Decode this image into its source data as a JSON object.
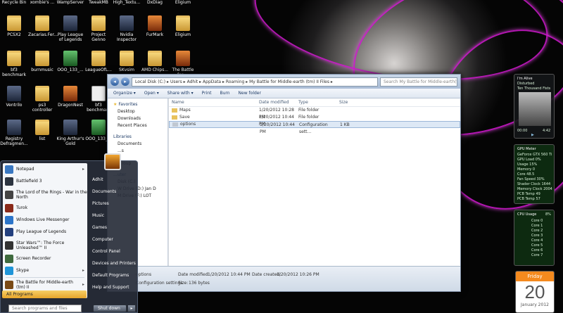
{
  "desktop": {
    "top_labels": [
      "Recycle Bin",
      "xombie's ...",
      "WampServer",
      "TweakMB",
      "High_Textu...",
      "DxDiag",
      "Eligium"
    ],
    "icons": [
      {
        "label": "PCSX2",
        "type": "folder"
      },
      {
        "label": "Zacarias.Fer...",
        "type": "folder"
      },
      {
        "label": "Play League of Legends",
        "type": "app"
      },
      {
        "label": "Project Genno",
        "type": "folder"
      },
      {
        "label": "Nvidia Inspector",
        "type": "app"
      },
      {
        "label": "FurMark",
        "type": "game"
      },
      {
        "label": "Eligium",
        "type": "folder"
      },
      {
        "label": "bf3 benchmark",
        "type": "folder"
      },
      {
        "label": "burnmusic",
        "type": "folder"
      },
      {
        "label": "OOO_133_...",
        "type": "green"
      },
      {
        "label": "LeagueOfL...",
        "type": "folder"
      },
      {
        "label": "SKvsim",
        "type": "folder"
      },
      {
        "label": "AMD Chips...",
        "type": "folder"
      },
      {
        "label": "The Battle for ...",
        "type": "game"
      },
      {
        "label": "Ventrilo",
        "type": "app"
      },
      {
        "label": "ps3 controller",
        "type": "folder"
      },
      {
        "label": "DragonNest",
        "type": "game"
      },
      {
        "label": "bf3 benchmark",
        "type": "doc"
      },
      {
        "label": "Registry Defragmen...",
        "type": "app"
      },
      {
        "label": "list",
        "type": "folder"
      },
      {
        "label": "King Arthur's Gold",
        "type": "app"
      },
      {
        "label": "OOO_133_...",
        "type": "green"
      }
    ]
  },
  "explorer": {
    "address": "Local Disk (C:)  ▸  Users  ▸  Adhit  ▸  AppData  ▸  Roaming  ▸  My Battle for Middle-earth (tm) II Files  ▸",
    "search_placeholder": "Search My Battle for Middle-earth(tm)...",
    "toolbar": [
      "Organize ▾",
      "Open ▾",
      "Share with ▾",
      "Print",
      "Burn",
      "New folder"
    ],
    "nav": {
      "favorites": "Favorites",
      "fav_items": [
        "Desktop",
        "Downloads",
        "Recent Places"
      ],
      "libraries": "Libraries",
      "lib_items": [
        "Documents"
      ],
      "lib_partial": [
        "...s",
        "...roup"
      ],
      "computer": "...uter",
      "drives": [
        "Disk (C:)",
        "W Drive (D:) Jan D",
        "M Drive (F:) LOT"
      ]
    },
    "columns": [
      "Name",
      "Date modified",
      "Type",
      "Size"
    ],
    "files": [
      {
        "name": "Maps",
        "date": "1/20/2012 10:28 PM",
        "type": "File folder",
        "size": "",
        "kind": "folder"
      },
      {
        "name": "Save",
        "date": "1/20/2012 10:44 PM",
        "type": "File folder",
        "size": "",
        "kind": "folder"
      },
      {
        "name": "options",
        "date": "1/20/2012 10:44 PM",
        "type": "Configuration sett...",
        "size": "1 KB",
        "kind": "cfg"
      }
    ],
    "details": {
      "name": "options",
      "subtype": "Configuration settings",
      "modified_label": "Date modified:",
      "modified": "1/20/2012 10:44 PM",
      "created_label": "Date created:",
      "created": "1/20/2012 10:26 PM",
      "size_label": "Size:",
      "size": "136 bytes"
    }
  },
  "startmenu": {
    "pinned": [
      "Notepad",
      "Battlefield 3",
      "The Lord of the Rings - War in the North",
      "Turok",
      "Windows Live Messenger",
      "Play League of Legends",
      "Star Wars™: The Force Unleashed™ II",
      "Screen Recorder",
      "Skype",
      "The Battle for Middle-earth (tm) II"
    ],
    "all_programs": "All Programs",
    "search_placeholder": "Search programs and files",
    "right_items": [
      "Adhit",
      "Documents",
      "Pictures",
      "Music",
      "Games",
      "Computer",
      "Control Panel",
      "Devices and Printers",
      "Default Programs",
      "Help and Support"
    ],
    "shutdown": "Shut down",
    "shutdown_arrow": "▸"
  },
  "gadgets": {
    "music": {
      "title": "I'm Alive",
      "artist": "Disturbed",
      "album": "Ten Thousand Fists",
      "time_start": "00:00",
      "time_end": "4:42"
    },
    "cpumeter": {
      "title": "GPU Meter",
      "lines": [
        "GeForce GTX 560 Ti",
        "GPU Load  0%",
        "Usage  15%",
        "Memory  0",
        "Core  48.5",
        "Fan Speed  30%",
        "Shader Clock 1644",
        "Memory Clock 2004",
        "PCB Temp 49",
        "PCB Temp 57"
      ]
    },
    "cpuusage": {
      "title": "CPU Usage",
      "value": "8%",
      "cores": [
        "Core 0",
        "Core 1",
        "Core 2",
        "Core 3",
        "Core 4",
        "Core 5",
        "Core 6",
        "Core 7"
      ]
    },
    "calendar": {
      "day_name": "Friday",
      "day": "20",
      "month_year": "January 2012"
    }
  }
}
